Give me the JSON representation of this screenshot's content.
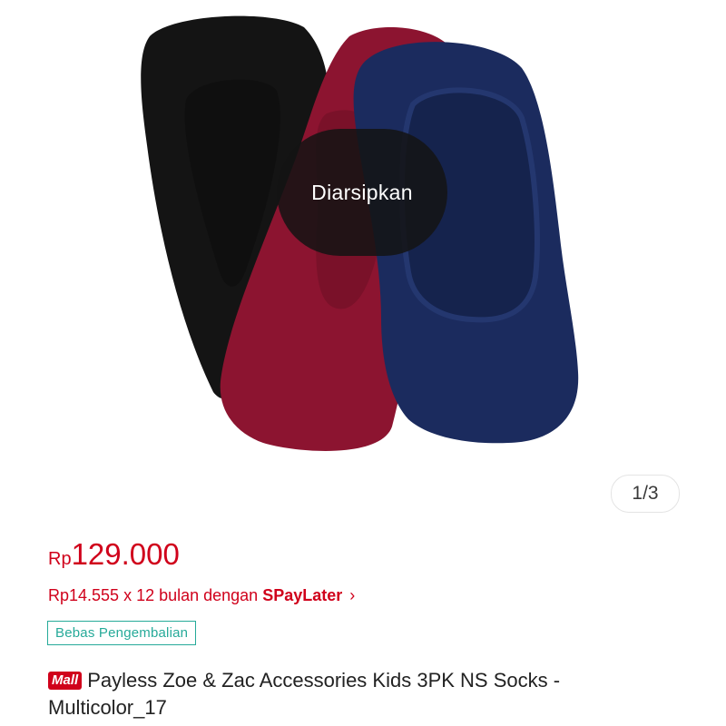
{
  "gallery": {
    "overlay_label": "Diarsipkan",
    "counter": "1/3",
    "sock_colors": {
      "black": "#141414",
      "maroon": "#8c1430",
      "navy": "#1b2b5e"
    }
  },
  "product": {
    "price_currency": "Rp",
    "price_value": "129.000",
    "installment_text": "Rp14.555 x 12 bulan dengan ",
    "installment_brand": "SPayLater",
    "installment_chevron": "›",
    "return_badge": "Bebas Pengembalian",
    "mall_badge": "Mall",
    "title": "Payless Zoe & Zac Accessories Kids 3PK NS Socks - Multicolor_17",
    "accent_color": "#d0011b",
    "badge_color": "#26aa99"
  }
}
